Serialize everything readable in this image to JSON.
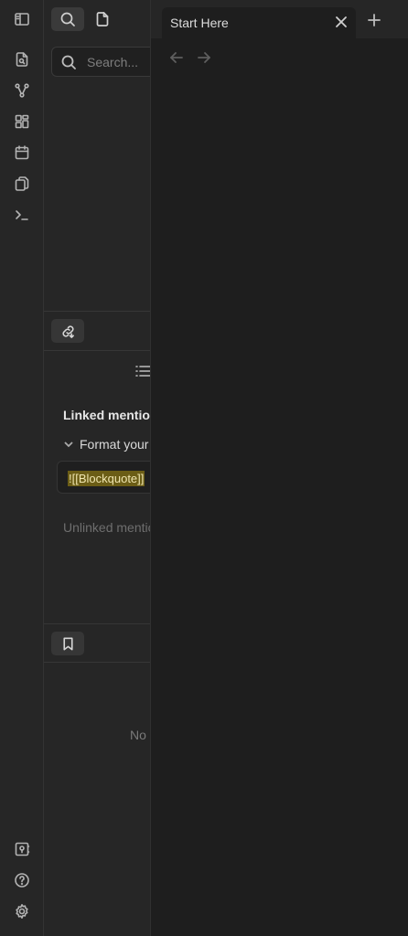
{
  "tab": {
    "title": "Start Here"
  },
  "search": {
    "placeholder": "Search..."
  },
  "backlinks": {
    "linked_title": "Linked mentions",
    "file_name": "Format your notes",
    "mention_text": "![[Blockquote]]",
    "unlinked_title": "Unlinked mentions"
  },
  "bookmarks": {
    "empty_text": "No bookmarks yet."
  },
  "colors": {
    "highlight_bg": "#6b5d16",
    "highlight_fg": "#f0e6b0",
    "accent": "#3a3a3a"
  },
  "icons": {
    "ribbon": [
      "open-quick-switcher-icon",
      "graph-view-icon",
      "canvas-icon",
      "daily-notes-icon",
      "templates-icon",
      "command-palette-icon"
    ],
    "bottom": [
      "vault-icon",
      "help-icon",
      "settings-icon"
    ]
  }
}
